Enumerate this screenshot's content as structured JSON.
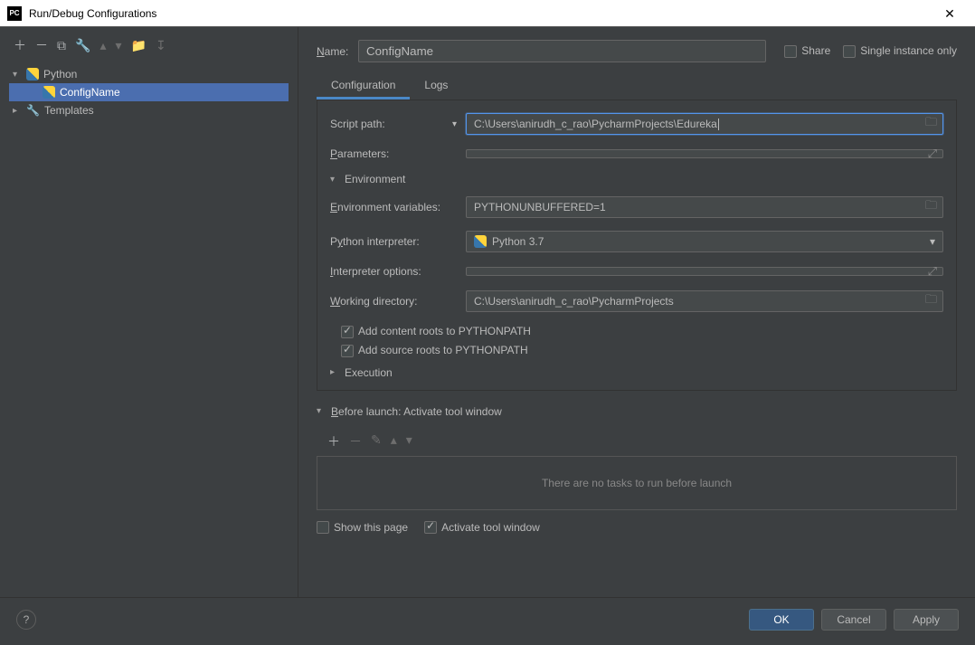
{
  "window": {
    "title": "Run/Debug Configurations"
  },
  "tree": {
    "python_label": "Python",
    "config_label": "ConfigName",
    "templates_label": "Templates"
  },
  "name": {
    "label": "Name:",
    "value": "ConfigName"
  },
  "options": {
    "share": "Share",
    "single_instance": "Single instance only"
  },
  "tabs": {
    "configuration": "Configuration",
    "logs": "Logs"
  },
  "form": {
    "script_path_label": "Script path:",
    "script_path_value": "C:\\Users\\anirudh_c_rao\\PycharmProjects\\Edureka",
    "parameters_label": "Parameters:",
    "parameters_value": ""
  },
  "environment": {
    "section": "Environment",
    "env_vars_label": "Environment variables:",
    "env_vars_value": "PYTHONUNBUFFERED=1",
    "interpreter_label": "Python interpreter:",
    "interpreter_value": "Python 3.7",
    "interp_opts_label": "Interpreter options:",
    "interp_opts_value": "",
    "workdir_label": "Working directory:",
    "workdir_value": "C:\\Users\\anirudh_c_rao\\PycharmProjects",
    "add_content_roots": "Add content roots to PYTHONPATH",
    "add_source_roots": "Add source roots to PYTHONPATH"
  },
  "execution": {
    "section": "Execution"
  },
  "before_launch": {
    "title": "Before launch: Activate tool window",
    "empty_msg": "There are no tasks to run before launch",
    "show_page": "Show this page",
    "activate_tool": "Activate tool window"
  },
  "buttons": {
    "ok": "OK",
    "cancel": "Cancel",
    "apply": "Apply"
  }
}
